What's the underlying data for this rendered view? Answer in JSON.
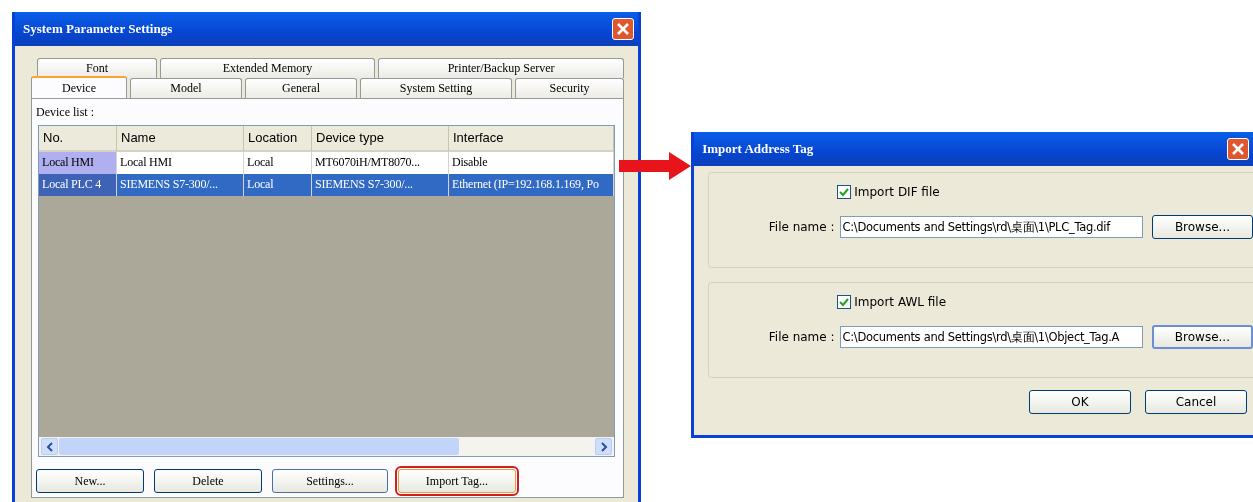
{
  "system_dialog": {
    "title": "System Parameter Settings",
    "tab_rows": [
      [
        {
          "label": "Font",
          "selected": false
        },
        {
          "label": "Extended Memory",
          "selected": false
        },
        {
          "label": "Printer/Backup Server",
          "selected": false
        }
      ],
      [
        {
          "label": "Device",
          "selected": true
        },
        {
          "label": "Model",
          "selected": false
        },
        {
          "label": "General",
          "selected": false
        },
        {
          "label": "System Setting",
          "selected": false
        },
        {
          "label": "Security",
          "selected": false
        }
      ]
    ],
    "list_label": "Device list :",
    "table": {
      "columns": [
        "No.",
        "Name",
        "Location",
        "Device type",
        "Interface"
      ],
      "rows": [
        {
          "cells": [
            "Local HMI",
            "Local HMI",
            "Local",
            "MT6070iH/MT8070...",
            "Disable"
          ],
          "selected": false
        },
        {
          "cells": [
            "Local PLC 4",
            "SIEMENS S7-300/...",
            "Local",
            "SIEMENS S7-300/...",
            "Ethernet (IP=192.168.1.169, Po"
          ],
          "selected": true
        }
      ]
    },
    "buttons": [
      {
        "label": "New...",
        "highlighted": false
      },
      {
        "label": "Delete",
        "highlighted": false
      },
      {
        "label": "Settings...",
        "highlighted": false
      },
      {
        "label": "Import Tag...",
        "highlighted": true
      }
    ]
  },
  "import_dialog": {
    "title": "Import Address Tag",
    "groups": [
      {
        "checkbox_label": "Import DIF file",
        "checked": true,
        "field_label": "File name :",
        "value": "C:\\Documents and Settings\\rd\\桌面\\1\\PLC_Tag.dif",
        "button": "Browse..."
      },
      {
        "checkbox_label": "Import AWL file",
        "checked": true,
        "field_label": "File name :",
        "value": "C:\\Documents and Settings\\rd\\桌面\\1\\Object_Tag.A",
        "button": "Browse..."
      }
    ],
    "buttons": [
      "OK",
      "Cancel"
    ]
  }
}
